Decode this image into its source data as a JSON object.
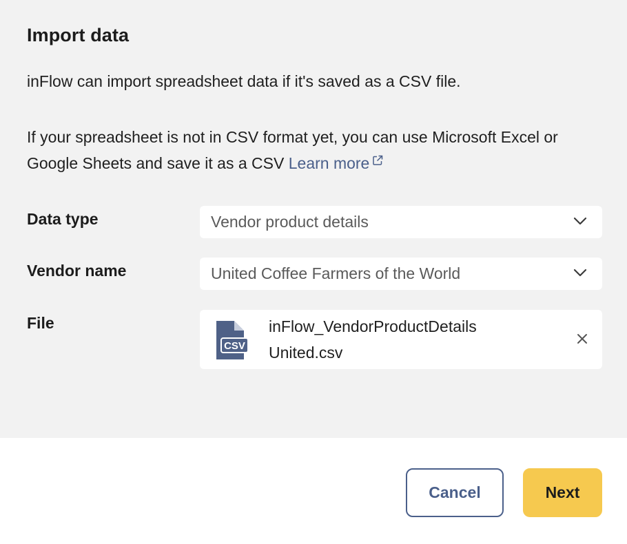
{
  "dialog": {
    "title": "Import data",
    "intro": "inFlow can import spreadsheet data if it's saved as a CSV file.",
    "help_text": "If your spreadsheet is not in CSV format yet, you can use Microsoft Excel or Google Sheets and save it as a CSV",
    "learn_more_label": "Learn more"
  },
  "form": {
    "data_type": {
      "label": "Data type",
      "value": "Vendor product details"
    },
    "vendor_name": {
      "label": "Vendor name",
      "value": "United Coffee Farmers of the World"
    },
    "file": {
      "label": "File",
      "name_line1": "inFlow_VendorProductDetails",
      "name_line2": "United.csv",
      "icon_text": "CSV",
      "icon": "csv-file-icon"
    }
  },
  "footer": {
    "cancel_label": "Cancel",
    "next_label": "Next"
  },
  "colors": {
    "panel_bg": "#f2f2f2",
    "link": "#4a5f8a",
    "primary_button": "#f6c94f",
    "file_icon": "#4f6187"
  }
}
